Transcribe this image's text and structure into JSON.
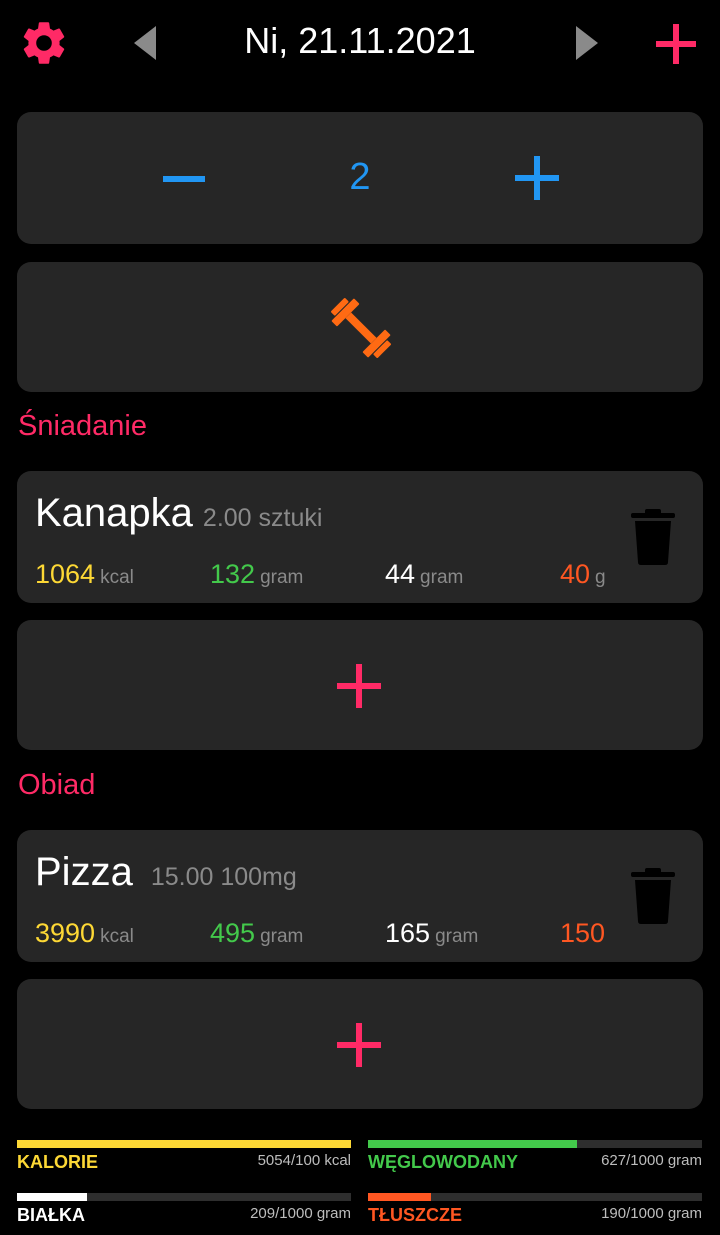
{
  "header": {
    "date": "Ni, 21.11.2021",
    "icons": {
      "settings": "gear-icon",
      "prev": "arrow-left-icon",
      "next": "arrow-right-icon",
      "add": "plus-icon"
    },
    "accent": "#ff2a66"
  },
  "counter": {
    "value": "2",
    "color": "#2196f3"
  },
  "workout": {
    "icon": "dumbbell-icon",
    "color": "#ff6a13"
  },
  "meals": [
    {
      "section": "Śniadanie",
      "item": {
        "name": "Kanapka",
        "quantity": "2.00 sztuki",
        "kcal": "1064",
        "kcal_unit": "kcal",
        "carbs": "132",
        "carbs_unit": "gram",
        "protein": "44",
        "protein_unit": "gram",
        "fat": "40",
        "fat_unit": "g"
      }
    },
    {
      "section": "Obiad",
      "item": {
        "name": "Pizza",
        "quantity": "15.00 100mg",
        "kcal": "3990",
        "kcal_unit": "kcal",
        "carbs": "495",
        "carbs_unit": "gram",
        "protein": "165",
        "protein_unit": "gram",
        "fat": "150",
        "fat_unit": ""
      }
    }
  ],
  "summary": [
    {
      "label": "KALORIE",
      "value": "5054/100 kcal",
      "fraction": 1.0,
      "color": "#fdd835"
    },
    {
      "label": "WĘGLOWODANY",
      "value": "627/1000 gram",
      "fraction": 0.627,
      "color": "#43c94b"
    },
    {
      "label": "BIAŁKA",
      "value": "209/1000 gram",
      "fraction": 0.209,
      "color": "#ffffff"
    },
    {
      "label": "TŁUSZCZE",
      "value": "190/1000 gram",
      "fraction": 0.19,
      "color": "#ff5722"
    }
  ]
}
